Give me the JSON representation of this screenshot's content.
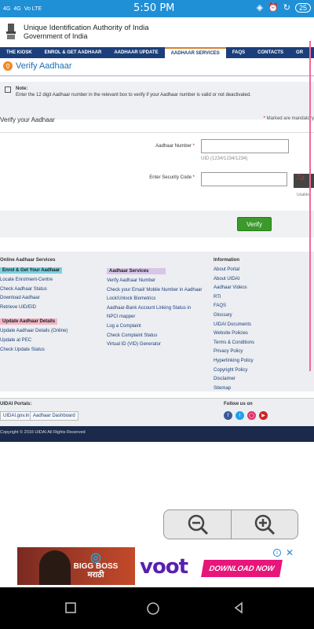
{
  "status_bar": {
    "indicators": [
      "4G",
      "4G",
      "Vo LTE"
    ],
    "time": "5:50 PM",
    "battery": "25"
  },
  "header": {
    "org_name": "Unique Identification Authority of India",
    "gov": "Government of India"
  },
  "nav": {
    "items": [
      "THE KIOSK",
      "ENROL & GET AADHAAR",
      "AADHAAR UPDATE",
      "AADHAAR SERVICES",
      "FAQS",
      "CONTACTS",
      "GR"
    ],
    "active_index": 3
  },
  "page_title": "Verify Aadhaar",
  "note": {
    "heading": "Note:",
    "text": "Enter the 12 digit Aadhaar number in the relevant box to verify if your Aadhaar number is valid or not deactivated."
  },
  "section": {
    "label": "Verify your Aadhaar",
    "mandatory": "Marked are mandatory"
  },
  "form": {
    "aadhaar_label": "Aadhaar Number",
    "aadhaar_value": "",
    "aadhaar_hint": "UID (1234/1234/1234)",
    "security_label": "Enter Security Code",
    "security_value": "",
    "captcha_text": "7a",
    "unable_text": "Unable",
    "verify_button": "Verify"
  },
  "footer": {
    "col1_heading": "Online Aadhaar Services",
    "enrol_heading": "Enrol & Get Your Aadhaar",
    "enrol_links": [
      "Locate Enrolment-Centre",
      "Check Aadhaar Status",
      "Download Aadhaar",
      "Retrieve UID/EID"
    ],
    "update_heading": "Update Aadhaar Details",
    "update_links": [
      "Update Aadhaar Details (Online)",
      "Update at PEC",
      "Check Update Status"
    ],
    "services_heading": "Aadhaar Services",
    "services_links": [
      "Verify Aadhaar Number",
      "Check your Email/ Mobile Number in Aadhaar",
      "Lock/Unlock Biometrics",
      "Aadhaar-Bank Account Linking Status in",
      "NPCI mapper",
      "Log a Complaint",
      "Check Complaint Status",
      "Virtual ID (VID) Generator"
    ],
    "info_heading": "Information",
    "info_links": [
      "About Portal",
      "About UIDAI",
      "Aadhaar Videos",
      "RTI",
      "FAQS",
      "Glossary",
      "UIDAI Documents",
      "Website Policies",
      "Terms & Conditions",
      "Privacy Policy",
      "Hyperlinking Policy",
      "Copyright Policy",
      "Disclaimer",
      "Sitemap"
    ]
  },
  "portals": {
    "label": "UIDAI Portals:",
    "links": [
      "UIDAI.gov.in",
      "Aadhaar Dashboard"
    ],
    "follow_label": "Follow us on"
  },
  "copyright": "Copyright © 2016 UIDAI All Rights Reserved",
  "ad": {
    "show_name": "BIGG BOSS",
    "show_sub": "मराठी",
    "brand": "voot",
    "cta": "DOWNLOAD NOW"
  },
  "colors": {
    "status_bar": "#1f8fd6",
    "nav_bg": "#1b3f7a",
    "accent_orange": "#f08a24",
    "verify_green": "#3a9a2a",
    "voot_purple": "#5a1fb0",
    "download_pink": "#e8157a"
  }
}
